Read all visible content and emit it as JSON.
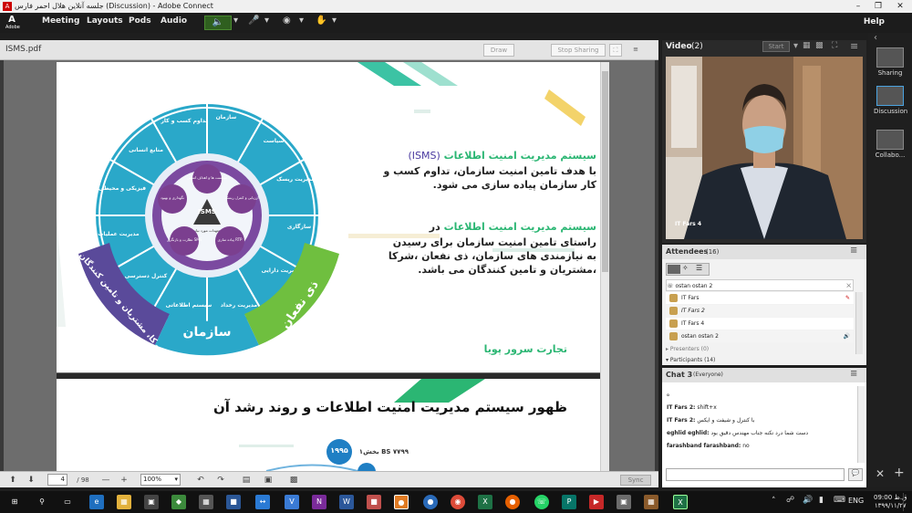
{
  "window": {
    "title": "جلسه آنلاین هلال احمر فارس (Discussion) - Adobe Connect"
  },
  "menu": {
    "items": [
      "Meeting",
      "Layouts",
      "Pods",
      "Audio"
    ],
    "help": "Help",
    "logo_text": "Adobe"
  },
  "share_pod": {
    "title": "ISMS.pdf",
    "draw_button": "Draw",
    "stop_sharing_button": "Stop Sharing",
    "page_current": "4",
    "page_total": "/ 98",
    "zoom": "100%",
    "sync_button": "Sync"
  },
  "slide1": {
    "heading1": "سیستم مدیریت امنیت اطلاعات",
    "heading1_suffix": "(ISMS)",
    "para1": "با هدف تامین امنیت سازمان، تداوم کسب و کار سازمان پیاده سازی می شود.",
    "heading2": "سیستم مدیریت امنیت اطلاعات",
    "heading2_suffix": "در",
    "para2": "راستای تامین امنیت سازمان برای رسیدن به نیازمندی های سازمان، ذی نفعان ،شرکا ،مشتریان و تامین کنندگان می باشد.",
    "signature": "تجارت سرور پویا",
    "diagram": {
      "center": "ISMS",
      "center_sub": "تعهدات مورد نیاز",
      "outer_segments": [
        "سازمان",
        "سیاست",
        "مدیریت ریسک",
        "سازگاری",
        "مدیریت دارایی",
        "مدیریت رخداد",
        "سیستم اطلاعاتی",
        "کنترل دسترسی",
        "مدیریت عملیات",
        "فیزیکی و محیطی",
        "منابع انسانی",
        "تداوم کسب و کار"
      ],
      "inner_circles": [
        "سیاست ها و اهداف امنیتی",
        "ارزیابی و کنترل ریسک",
        "پیاده سازی RTP",
        "نظارت و بازنگری SMS",
        "نگهداری و بهبود"
      ],
      "band_left": "شرکا، مشتریان و تامین کنندگان",
      "band_bottom": "سازمان",
      "band_right": "ذی نفعان"
    }
  },
  "slide2": {
    "heading": "ظهور سیستم مدیریت امنیت اطلاعات و روند رشد آن",
    "year_badge": "۱۹۹۵",
    "bs_label": "BS ۷۷۹۹ بخش۱"
  },
  "video_pod": {
    "title": "Video",
    "count": "(2)",
    "start_button": "Start",
    "participant_name": "IT Fars 4"
  },
  "attendees_pod": {
    "title": "Attendees",
    "count": "(16)",
    "current_user": "ostan ostan 2",
    "rows": [
      "IT Fars",
      "IT Fars 2",
      "IT Fars 4",
      "ostan ostan 2"
    ],
    "presenters": "Presenters (0)",
    "participants": "Participants (14)"
  },
  "chat_pod": {
    "title": "Chat 3",
    "scope": "(Everyone)",
    "messages": [
      {
        "sender": "",
        "text": "ه"
      },
      {
        "sender": "IT Fars 2:",
        "text": "shift+x"
      },
      {
        "sender": "IT Fars 2:",
        "text": "با کنترل و شیفت و ایکس"
      },
      {
        "sender": "eghlid eghlid:",
        "text": "دست شما درد نکنه جناب مهندس دقیق بود"
      },
      {
        "sender": "farashband farashband:",
        "text": "no"
      }
    ]
  },
  "right_rail": {
    "items": [
      "Sharing",
      "Discussion",
      "Collabo..."
    ]
  },
  "taskbar": {
    "language": "ENG",
    "time": "09:00",
    "period": "ق.ظ",
    "date": "۱۳۹۹/۱۱/۲۷"
  }
}
